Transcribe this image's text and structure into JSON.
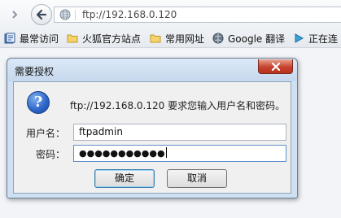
{
  "toolbar": {
    "url": "ftp://192.168.0.120"
  },
  "bookmarks": [
    {
      "label": "最常访问",
      "icon": "bookmarks-icon"
    },
    {
      "label": "火狐官方站点",
      "icon": "folder-icon"
    },
    {
      "label": "常用网址",
      "icon": "folder-icon"
    },
    {
      "label": "Google 翻译",
      "icon": "globe-icon"
    },
    {
      "label": "正在连",
      "icon": "play-icon"
    }
  ],
  "dialog": {
    "title": "需要授权",
    "message": "ftp://192.168.0.120 要求您输入用户名和密码。",
    "username_label": "用户名：",
    "password_label": "密码：",
    "username_value": "ftpadmin",
    "password_value": "●●●●●●●●●●●",
    "ok_label": "确定",
    "cancel_label": "取消"
  },
  "colors": {
    "dialog_frame": "#cfe0f3",
    "close_button": "#c7432d",
    "focus_border": "#5e8fc8"
  }
}
